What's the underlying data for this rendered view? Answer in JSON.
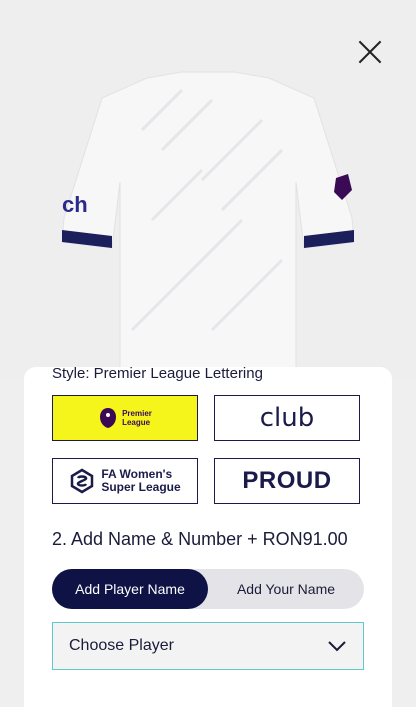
{
  "header": {
    "close_icon": "close-icon"
  },
  "product": {
    "image_alt": "white home shirt, back view"
  },
  "style": {
    "title": "Style: Premier League Lettering",
    "options": [
      {
        "id": "premier-league",
        "line1": "Premier",
        "line2": "League",
        "selected": true
      },
      {
        "id": "club",
        "label": "club",
        "selected": false
      },
      {
        "id": "fa-wsl",
        "line1": "FA Women's",
        "line2": "Super League",
        "selected": false
      },
      {
        "id": "proud",
        "label": "PROUD",
        "selected": false
      }
    ]
  },
  "name_number": {
    "title": "2. Add Name & Number + RON91.00",
    "toggle": {
      "active": "Add Player Name",
      "inactive": "Add Your Name"
    },
    "select": {
      "value": "Choose Player",
      "icon": "chevron-down-icon"
    }
  },
  "colors": {
    "navy": "#0e1245",
    "selected_tile": "#f5f51b",
    "select_border": "#5ec8cc"
  }
}
